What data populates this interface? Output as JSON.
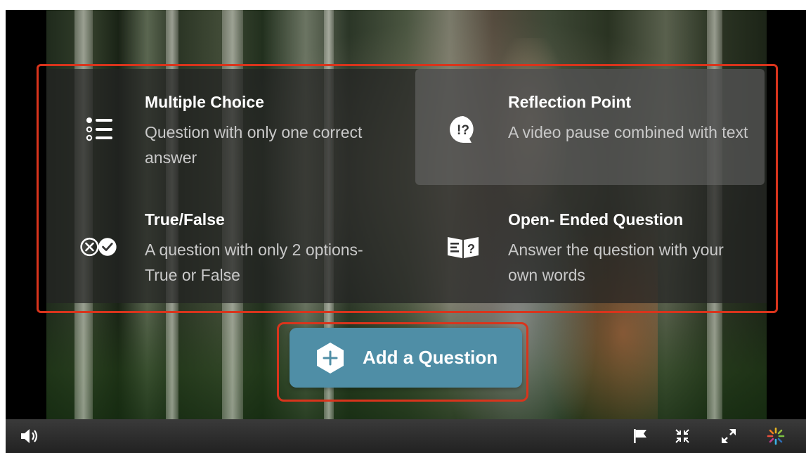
{
  "options": [
    {
      "title": "Multiple Choice",
      "description": "Question with only one correct answer",
      "icon": "list-icon"
    },
    {
      "title": "Reflection Point",
      "description": "A video pause combined with text",
      "icon": "speech-bubble-exclaim-question-icon"
    },
    {
      "title": "True/False",
      "description": "A question with only 2 options- True or False",
      "icon": "x-check-circles-icon"
    },
    {
      "title": "Open- Ended Question",
      "description": "Answer the question with your own words",
      "icon": "book-question-icon"
    }
  ],
  "add_button": {
    "label": "Add a Question",
    "icon": "plus-hexagon-icon"
  },
  "controls": {
    "volume_icon": "volume-icon",
    "flag_icon": "flag-icon",
    "shrink_icon": "shrink-icon",
    "fullscreen_icon": "fullscreen-icon",
    "logo_icon": "kaltura-logo-icon"
  },
  "colors": {
    "accent": "#4f8ea6",
    "highlight_border": "#d9341c",
    "panel": "#232323"
  }
}
